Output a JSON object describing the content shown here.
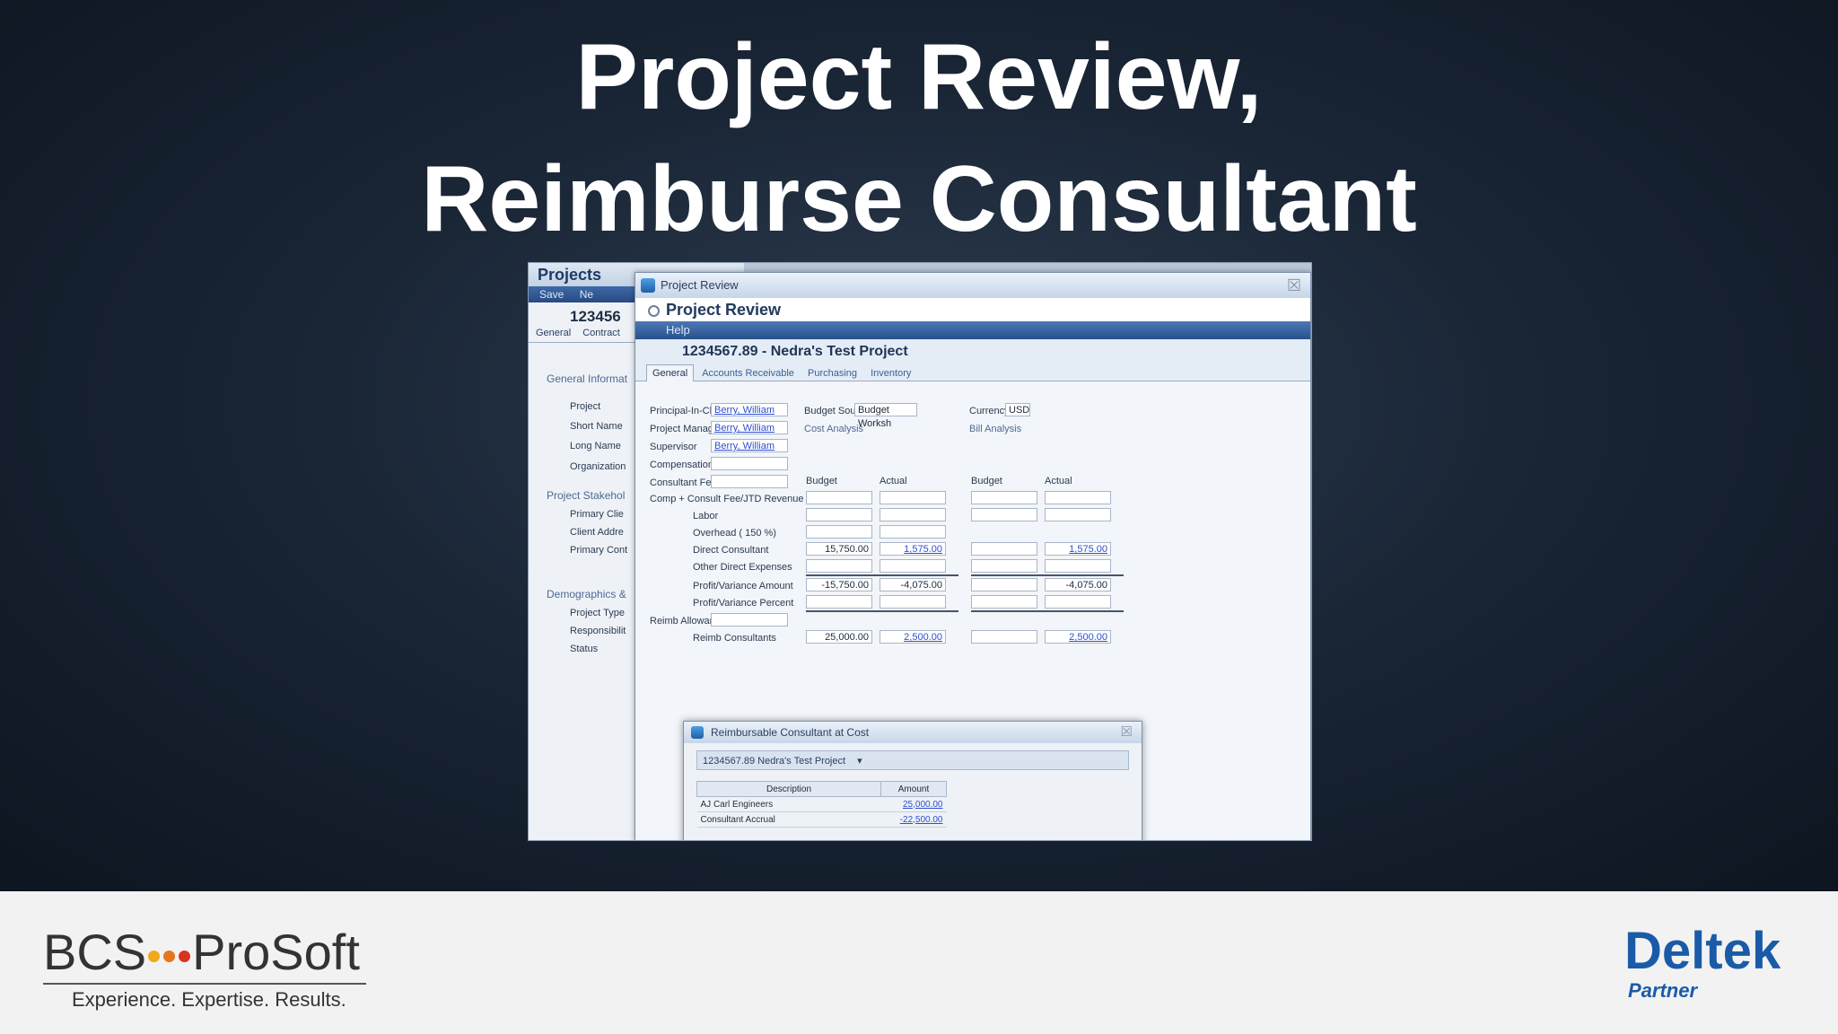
{
  "slide": {
    "title_line1": "Project Review,",
    "title_line2": "Reimburse Consultant"
  },
  "projects_window": {
    "title": "Projects",
    "toolbar_save": "Save",
    "toolbar_new": "Ne",
    "project_number": "123456",
    "tabs": [
      "General",
      "Contract"
    ],
    "groups": [
      "General Informat",
      "Project Stakehol",
      "Demographics &"
    ],
    "labels": [
      "Project",
      "Short Name",
      "Long Name",
      "Organization",
      "Primary Clie",
      "Client Addre",
      "Primary Cont",
      "Project Type",
      "Responsibilit",
      "Status"
    ]
  },
  "review_window": {
    "caption": "Project Review",
    "title": "Project  Review",
    "help": "Help",
    "project_heading": "1234567.89 - Nedra's Test Project",
    "tabs": [
      "General",
      "Accounts Receivable",
      "Purchasing",
      "Inventory"
    ],
    "principal_label": "Principal-In-Char",
    "principal_value": "Berry, William",
    "pm_label": "Project Manager",
    "pm_value": "Berry, William",
    "supervisor_label": "Supervisor",
    "supervisor_value": "Berry, William",
    "compensation_label": "Compensation",
    "consultant_fee_label": "Consultant Fee",
    "budget_source_label": "Budget Source",
    "budget_source_value": "Budget Worksh",
    "currency_label": "Currency",
    "currency_value": "USD",
    "cost_analysis": "Cost Analysis",
    "bill_analysis": "Bill Analysis",
    "col_budget": "Budget",
    "col_actual": "Actual",
    "comp_row_label": "Comp + Consult Fee/JTD Revenue",
    "labor_label": "Labor",
    "overhead_label": "Overhead ( 150 %)",
    "direct_consultant_label": "Direct Consultant",
    "other_direct_label": "Other Direct Expenses",
    "profit_amount_label": "Profit/Variance Amount",
    "profit_percent_label": "Profit/Variance Percent",
    "reimb_allowance_label": "Reimb Allowance",
    "reimb_consultants_label": "Reimb Consultants",
    "direct_consultant_cost_budget": "15,750.00",
    "direct_consultant_cost_actual": "1,575.00",
    "direct_consultant_bill_actual": "1,575.00",
    "profit_cost_budget": "-15,750.00",
    "profit_cost_actual": "-4,075.00",
    "profit_bill_actual": "-4,075.00",
    "reimb_cost_budget": "25,000.00",
    "reimb_cost_actual": "2,500.00",
    "reimb_bill_actual": "2,500.00"
  },
  "popup": {
    "caption": "Reimbursable Consultant at Cost",
    "crumb": "1234567.89 Nedra's Test Project",
    "col_description": "Description",
    "col_amount": "Amount",
    "rows": [
      {
        "description": "AJ Carl Engineers",
        "amount": "25,000.00"
      },
      {
        "description": "Consultant Accrual",
        "amount": "-22,500.00"
      }
    ]
  },
  "footer": {
    "bcs_name_left": "BCS",
    "bcs_name_right": "ProSoft",
    "bcs_tagline": "Experience. Expertise. Results.",
    "deltek_name": "Deltek",
    "deltek_partner": "Partner"
  }
}
